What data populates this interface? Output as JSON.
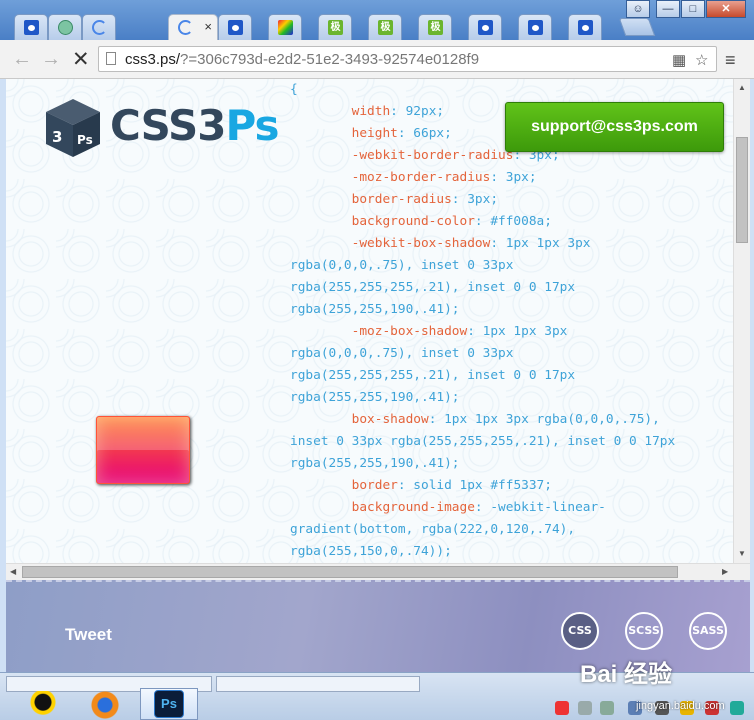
{
  "browser": {
    "tabs": [
      {
        "icon": "paw-icon",
        "active": false
      },
      {
        "icon": "mint-icon",
        "active": false
      },
      {
        "icon": "loading-icon",
        "active": false
      },
      {
        "icon": "loading-icon",
        "active": true,
        "close": "×"
      },
      {
        "icon": "paw-icon",
        "active": false
      },
      {
        "icon": "color-icon",
        "active": false
      },
      {
        "icon": "green-icon",
        "label": "极",
        "active": false
      },
      {
        "icon": "green-icon",
        "label": "极",
        "active": false
      },
      {
        "icon": "green-icon",
        "label": "极",
        "active": false
      },
      {
        "icon": "paw-icon",
        "active": false
      },
      {
        "icon": "paw-icon",
        "active": false
      },
      {
        "icon": "paw-icon",
        "active": false
      }
    ],
    "window_controls": {
      "minimize": "—",
      "maximize": "□",
      "close": "✕"
    },
    "nav": {
      "back": "←",
      "forward": "→",
      "stop": "✕"
    },
    "url": {
      "host": "css3.ps/",
      "rest": "?=306c793d-e2d2-51e2-3493-92574e0128f9"
    },
    "menu_icon": "≡"
  },
  "page": {
    "logo": {
      "text_a": "CSS3",
      "text_b": "Ps",
      "box_label": "3 Ps"
    },
    "support_button": "support@css3ps.com",
    "code_lines": [
      {
        "t": "{",
        "k": "v"
      },
      {
        "t": "        width",
        "k": "p",
        "v": ": 92px;"
      },
      {
        "t": "        height",
        "k": "p",
        "v": ": 66px;"
      },
      {
        "t": "        -webkit-border-radius",
        "k": "p",
        "v": ": 3px;"
      },
      {
        "t": "        -moz-border-radius",
        "k": "p",
        "v": ": 3px;"
      },
      {
        "t": "        border-radius",
        "k": "p",
        "v": ": 3px;"
      },
      {
        "t": "        background-color",
        "k": "p",
        "v": ": #ff008a;"
      },
      {
        "t": "        -webkit-box-shadow",
        "k": "p",
        "v": ": 1px 1px 3px"
      },
      {
        "t": "rgba(0,0,0,.75), inset 0 33px",
        "k": "v"
      },
      {
        "t": "rgba(255,255,255,.21), inset 0 0 17px",
        "k": "v"
      },
      {
        "t": "rgba(255,255,190,.41);",
        "k": "v"
      },
      {
        "t": "        -moz-box-shadow",
        "k": "p",
        "v": ": 1px 1px 3px"
      },
      {
        "t": "rgba(0,0,0,.75), inset 0 33px",
        "k": "v"
      },
      {
        "t": "rgba(255,255,255,.21), inset 0 0 17px",
        "k": "v"
      },
      {
        "t": "rgba(255,255,190,.41);",
        "k": "v"
      },
      {
        "t": "        box-shadow",
        "k": "p",
        "v": ": 1px 1px 3px rgba(0,0,0,.75),"
      },
      {
        "t": "inset 0 33px rgba(255,255,255,.21), inset 0 0 17px",
        "k": "v"
      },
      {
        "t": "rgba(255,255,190,.41);",
        "k": "v"
      },
      {
        "t": "        border",
        "k": "p",
        "v": ": solid 1px #ff5337;"
      },
      {
        "t": "        background-image",
        "k": "p",
        "v": ": -webkit-linear-"
      },
      {
        "t": "gradient(bottom, rgba(222,0,120,.74),",
        "k": "v"
      },
      {
        "t": "rgba(255,150,0,.74));",
        "k": "v"
      }
    ]
  },
  "footer": {
    "tweet": "Tweet",
    "formats": [
      {
        "label": "CSS",
        "active": true
      },
      {
        "label": "SCSS",
        "active": false
      },
      {
        "label": "SASS",
        "active": false
      }
    ]
  },
  "taskbar": {
    "apps": [
      "qq-icon",
      "firefox-icon",
      "photoshop-icon"
    ],
    "ps_label": "Ps"
  },
  "watermark": {
    "text": "Bai 经验",
    "sub": "jingyan.baidu.com"
  },
  "colors": {
    "accent_green": "#4caf0f",
    "logo_blue": "#19a7e2",
    "logo_dark": "#33475c"
  }
}
